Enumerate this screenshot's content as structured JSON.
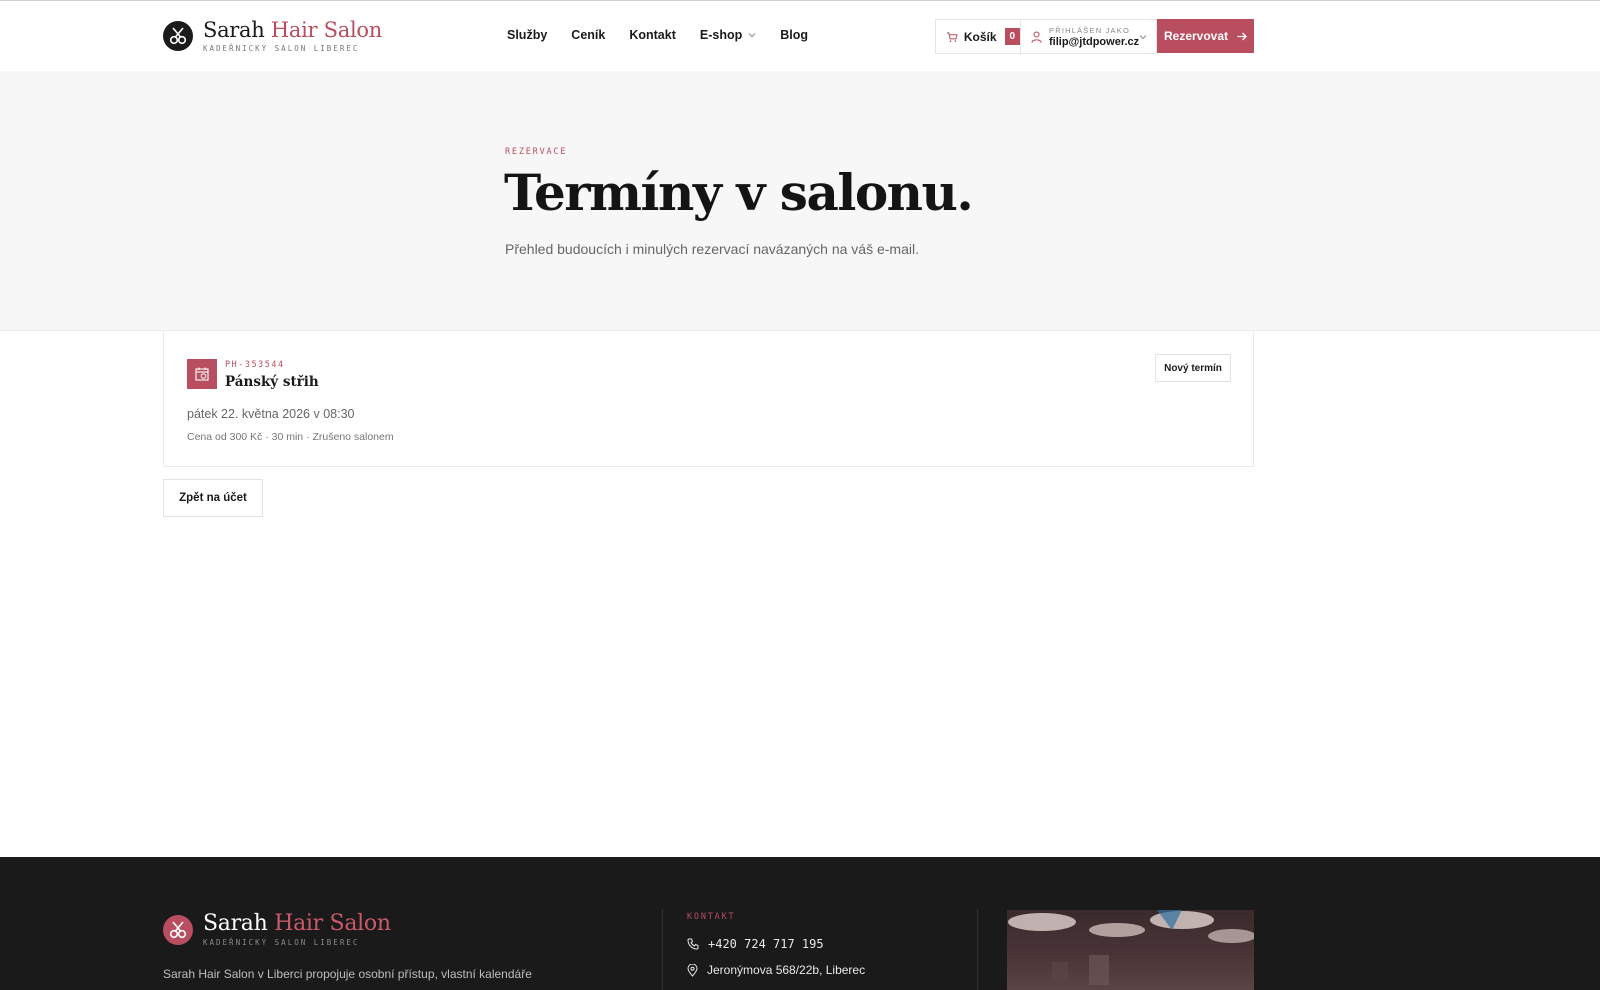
{
  "brand": {
    "name_part1": "Sarah",
    "name_part2": "Hair Salon",
    "subtitle": "KADEŘNICKÝ SALON LIBEREC"
  },
  "nav": {
    "items": [
      {
        "label": "Služby"
      },
      {
        "label": "Ceník"
      },
      {
        "label": "Kontakt"
      },
      {
        "label": "E-shop"
      },
      {
        "label": "Blog"
      }
    ]
  },
  "cart": {
    "label": "Košík",
    "count": "0"
  },
  "user": {
    "label": "PŘIHLÁŠEN JAKO",
    "email": "filip@jtdpower.cz"
  },
  "book_button": "Rezervovat",
  "hero": {
    "eyebrow": "REZERVACE",
    "title": "Termíny v salonu.",
    "description": "Přehled budoucích i minulých rezervací navázaných na váš e-mail."
  },
  "reservation": {
    "code": "PH-353544",
    "service": "Pánský střih",
    "date": "pátek 22. května 2026 v 08:30",
    "meta": "Cena od 300 Kč · 30 min · Zrušeno salonem",
    "new_button": "Nový termín"
  },
  "back_button": "Zpět na účet",
  "footer": {
    "description": "Sarah Hair Salon v Liberci propojuje osobní přístup, vlastní kalendáře",
    "contact_title": "KONTAKT",
    "phone": "+420 724 717 195",
    "address": "Jeronýmova 568/22b, Liberec"
  },
  "colors": {
    "accent": "#b84e5f",
    "dark": "#1a1a1a",
    "hero_bg": "#f7f7f7"
  }
}
